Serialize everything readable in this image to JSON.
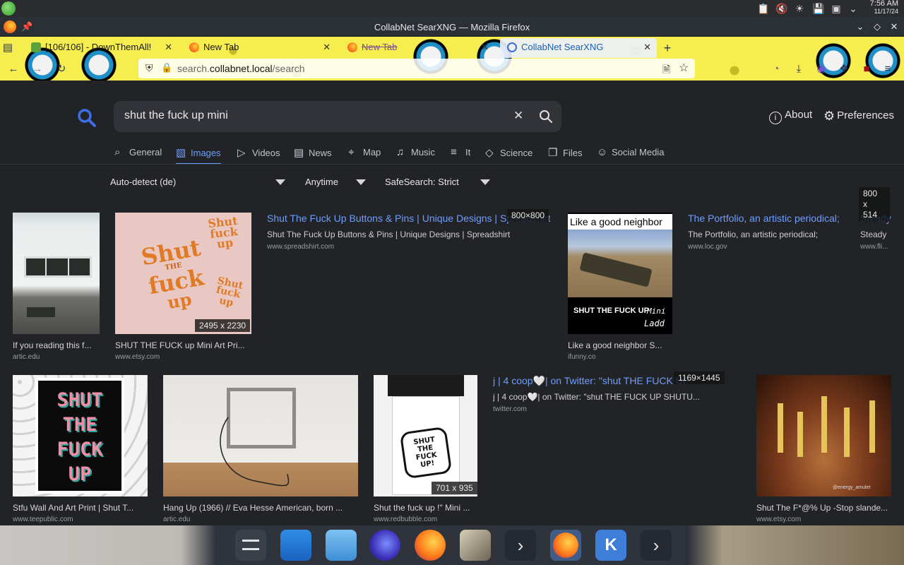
{
  "systray": {
    "clock_time": "7:56 AM",
    "clock_date": "11/17/24"
  },
  "window": {
    "title": "CollabNet SearXNG — Mozilla Firefox"
  },
  "tabs": [
    {
      "label": "[106/106] - DownThemAll!",
      "state": "normal"
    },
    {
      "label": "New Tab",
      "state": "normal"
    },
    {
      "label": "New Tab",
      "state": "faded"
    },
    {
      "label": "CollabNet SearXNG",
      "state": "active"
    }
  ],
  "urlbar": {
    "prefix": "search.",
    "domain": "collabnet.local",
    "path": "/search"
  },
  "search": {
    "query": "shut the fuck up mini"
  },
  "header": {
    "about_label": "About",
    "preferences_label": "Preferences"
  },
  "categories": [
    {
      "label": "General",
      "icon": "search-icon"
    },
    {
      "label": "Images",
      "icon": "image-icon",
      "active": true
    },
    {
      "label": "Videos",
      "icon": "play-icon"
    },
    {
      "label": "News",
      "icon": "newspaper-icon"
    },
    {
      "label": "Map",
      "icon": "map-pin-icon"
    },
    {
      "label": "Music",
      "icon": "music-note-icon"
    },
    {
      "label": "It",
      "icon": "layers-icon"
    },
    {
      "label": "Science",
      "icon": "graduation-cap-icon"
    },
    {
      "label": "Files",
      "icon": "files-icon"
    },
    {
      "label": "Social Media",
      "icon": "people-icon"
    }
  ],
  "filters": {
    "language": "Auto-detect (de)",
    "time": "Anytime",
    "safesearch": "SafeSearch: Strict"
  },
  "results_row1": [
    {
      "title": "If you reading this f...",
      "site": "artic.edu"
    },
    {
      "title": "SHUT THE FUCK up Mini Art Pri...",
      "site": "www.etsy.com",
      "badge": "2495 x 2230",
      "art_line1": "Shut",
      "art_line2": "THE",
      "art_line3": "fuck",
      "art_line4": "up"
    },
    {
      "link_title": "Shut The Fuck Up Buttons & Pins | Unique Designs | Spreadshirt",
      "desc": "Shut The Fuck Up Buttons & Pins | Unique Designs | Spreadshirt",
      "site": "www.spreadshirt.com",
      "badge": "800×800"
    },
    {
      "title": "Like a good neighbor S...",
      "site": "ifunny.co",
      "caption_top": "Like a good neighbor",
      "caption_bottom": "SHUT THE FUCK UP",
      "caption_mini": "Mini",
      "caption_ladd": "Ladd"
    },
    {
      "link_title": "The Portfolio, an artistic periodical;",
      "desc": "The Portfolio, an artistic periodical;",
      "site": "www.loc.gov"
    },
    {
      "link_title": "Steady",
      "desc": "Steady",
      "site": "www.fli...",
      "badge_w": "800",
      "badge_x": "x",
      "badge_h": "514"
    }
  ],
  "results_row2": [
    {
      "title": "Stfu Wall And Art Print | Shut T...",
      "site": "www.teepublic.com",
      "art_line1": "SHUT",
      "art_line2": "THE",
      "art_line3": "FUCK",
      "art_line4": "UP"
    },
    {
      "title": "Hang Up (1966) // Eva Hesse American, born ...",
      "site": "artic.edu"
    },
    {
      "title": "Shut the fuck up !\" Mini ...",
      "site": "www.redbubble.com",
      "badge": "701 x 935",
      "art_line1": "SHUT",
      "art_line2": "THE",
      "art_line3": "FUCK",
      "art_line4": "UP!"
    },
    {
      "link_title": "j | 4 coop🤍| on Twitter: \"shut THE FUCK UP",
      "desc": "j | 4 coop🤍| on Twitter: \"shut THE FUCK UP SHUTU...",
      "site": "twitter.com",
      "badge": "1169×1445"
    },
    {
      "title": "Shut The F*@% Up -Stop slande...",
      "site": "www.etsy.com",
      "watermark": "@energy_amulet"
    }
  ],
  "colors": {
    "accent": "#6d9eff",
    "page_bg": "#222326",
    "search_bg": "#313338",
    "theme_yellow": "#f6ee4e"
  }
}
